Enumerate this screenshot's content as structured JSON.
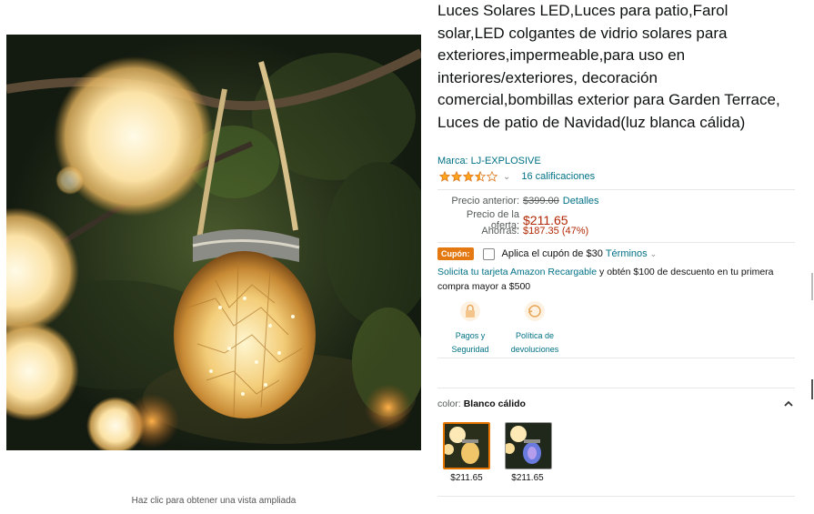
{
  "product": {
    "title": "Luces Solares LED,Luces para patio,Farol solar,LED colgantes de vidrio solares para exteriores,impermeable,para uso en interiores/exteriores, decoración comercial,bombillas exterior para Garden Terrace, Luces de patio de Navidad(luz blanca cálida)",
    "brand": "Marca: LJ-EXPLOSIVE",
    "rating_value": 3.5,
    "ratings_count": "16 calificaciones",
    "rating_chevron": "⌄"
  },
  "image": {
    "caption": "Haz clic para obtener una vista ampliada"
  },
  "price": {
    "prev_label": "Precio anterior:",
    "prev_value": "$399.00",
    "details_link": "Detalles",
    "offer_label": "Precio de la oferta:",
    "offer_value": "$211.65",
    "save_label": "Ahorras:",
    "save_value": "$187.35 (47%)"
  },
  "coupon": {
    "badge": "Cupón:",
    "text": "Aplica el cupón de $30",
    "terms": "Términos",
    "chevron": "⌄"
  },
  "promo": {
    "link": "Solicita tu tarjeta Amazon Recargable",
    "text": " y obtén $100 de descuento en tu primera compra mayor a $500"
  },
  "badges": [
    {
      "icon": "lock-icon",
      "line1": "Pagos y",
      "line2": "Seguridad"
    },
    {
      "icon": "return-icon",
      "line1": "Política de",
      "line2": "devoluciones"
    }
  ],
  "color": {
    "label": "color:",
    "selected": "Blanco cálido",
    "collapse_icon": "chevron-up-icon",
    "options": [
      {
        "price": "$211.65",
        "selected": true
      },
      {
        "price": "$211.65",
        "selected": false
      }
    ]
  },
  "colors": {
    "link": "#007185",
    "price_red": "#b12704",
    "coupon_orange": "#e47911",
    "star": "#ffa41c",
    "selected_border": "#e77600"
  }
}
